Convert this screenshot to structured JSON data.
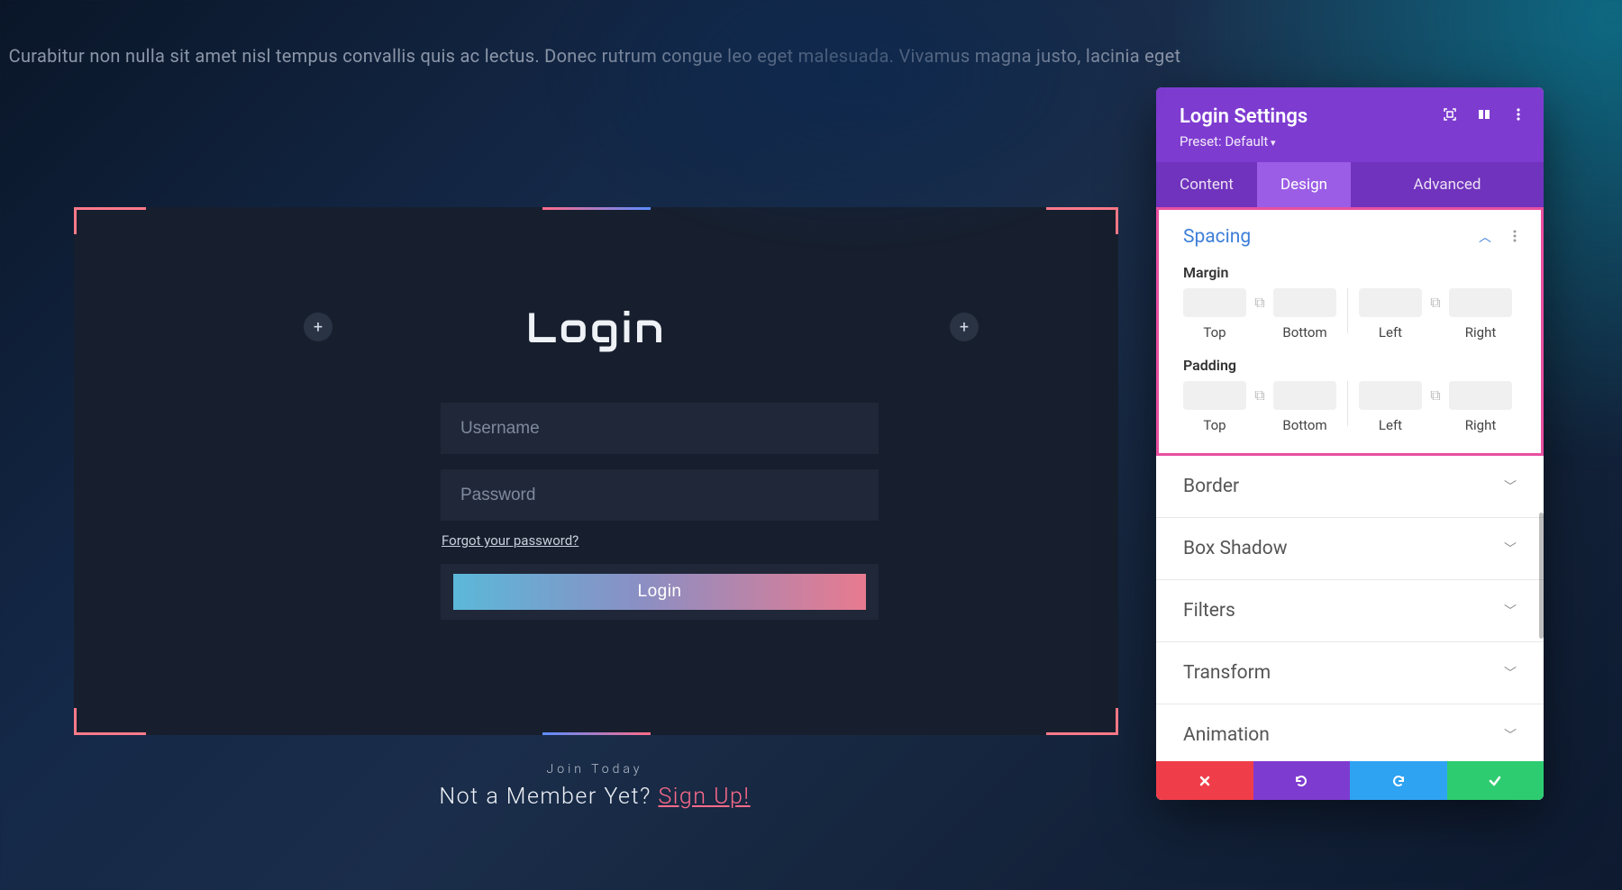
{
  "intro": "Curabitur non nulla sit amet nisl tempus convallis quis ac lectus. Donec rutrum congue leo eget malesuada. Vivamus magna justo, lacinia eget",
  "login": {
    "title": "Login",
    "username_placeholder": "Username",
    "password_placeholder": "Password",
    "forgot": "Forgot your password?",
    "button": "Login"
  },
  "join": {
    "small": "Join Today",
    "prefix": "Not a Member Yet? ",
    "link": "Sign Up!"
  },
  "settings": {
    "title": "Login Settings",
    "preset": "Preset: Default",
    "tabs": {
      "content": "Content",
      "design": "Design",
      "advanced": "Advanced"
    },
    "spacing": {
      "title": "Spacing",
      "margin_label": "Margin",
      "padding_label": "Padding",
      "labels": {
        "top": "Top",
        "bottom": "Bottom",
        "left": "Left",
        "right": "Right"
      },
      "margin": {
        "top": "",
        "bottom": "",
        "left": "",
        "right": ""
      },
      "padding": {
        "top": "",
        "bottom": "",
        "left": "",
        "right": ""
      }
    },
    "sections": {
      "border": "Border",
      "box_shadow": "Box Shadow",
      "filters": "Filters",
      "transform": "Transform",
      "animation": "Animation"
    }
  }
}
